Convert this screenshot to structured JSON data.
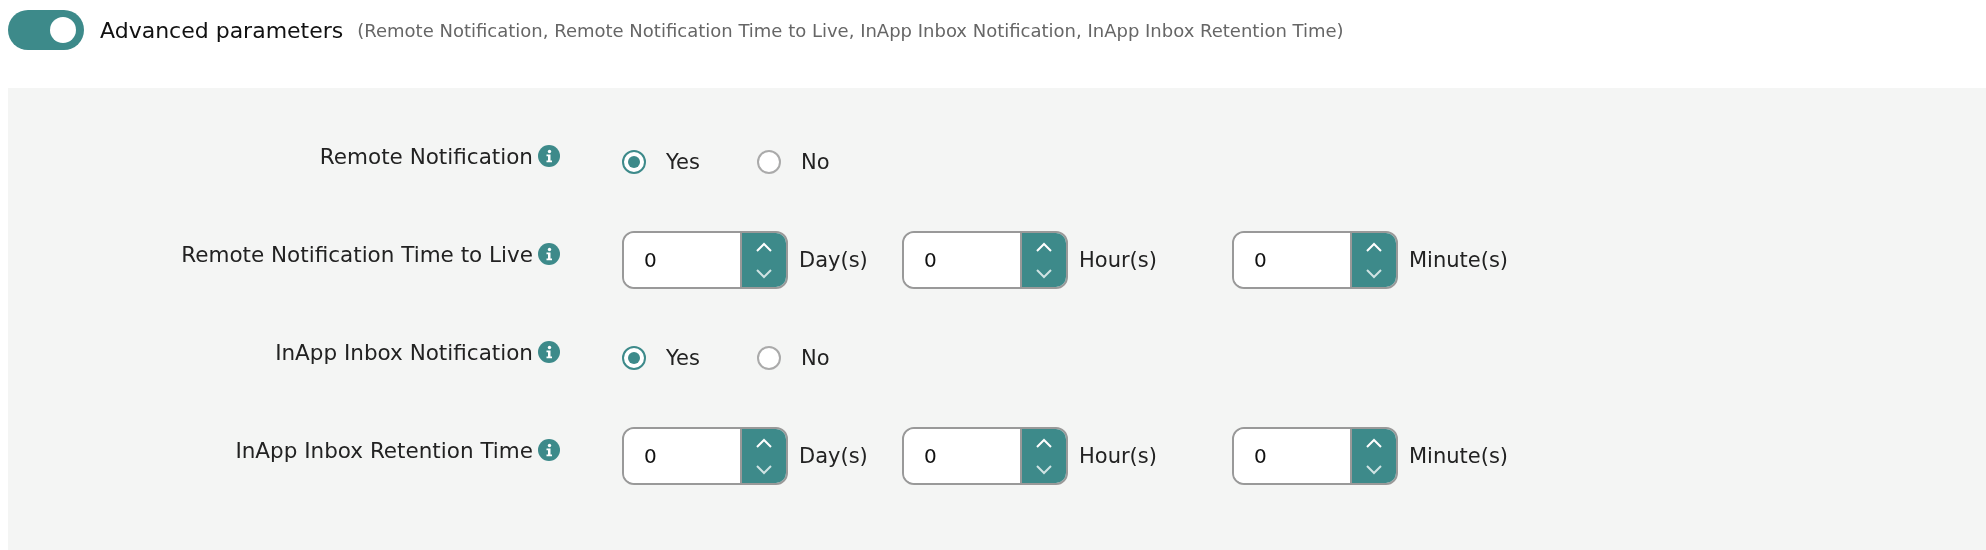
{
  "toggle": {
    "on": true,
    "label": "Advanced parameters",
    "hint": "(Remote Notification, Remote Notification Time to Live, InApp Inbox Notification, InApp Inbox Retention Time)"
  },
  "fields": [
    {
      "kind": "radio",
      "label": "Remote Notification",
      "options": [
        {
          "label": "Yes",
          "selected": true
        },
        {
          "label": "No",
          "selected": false
        }
      ]
    },
    {
      "kind": "duration",
      "label": "Remote Notification Time to Live",
      "inputs": [
        {
          "value": "0",
          "unit": "Day(s)"
        },
        {
          "value": "0",
          "unit": "Hour(s)"
        },
        {
          "value": "0",
          "unit": "Minute(s)"
        }
      ]
    },
    {
      "kind": "radio",
      "label": "InApp Inbox Notification",
      "options": [
        {
          "label": "Yes",
          "selected": true
        },
        {
          "label": "No",
          "selected": false
        }
      ]
    },
    {
      "kind": "duration",
      "label": "InApp Inbox Retention Time",
      "inputs": [
        {
          "value": "0",
          "unit": "Day(s)"
        },
        {
          "value": "0",
          "unit": "Hour(s)"
        },
        {
          "value": "0",
          "unit": "Minute(s)"
        }
      ]
    }
  ]
}
